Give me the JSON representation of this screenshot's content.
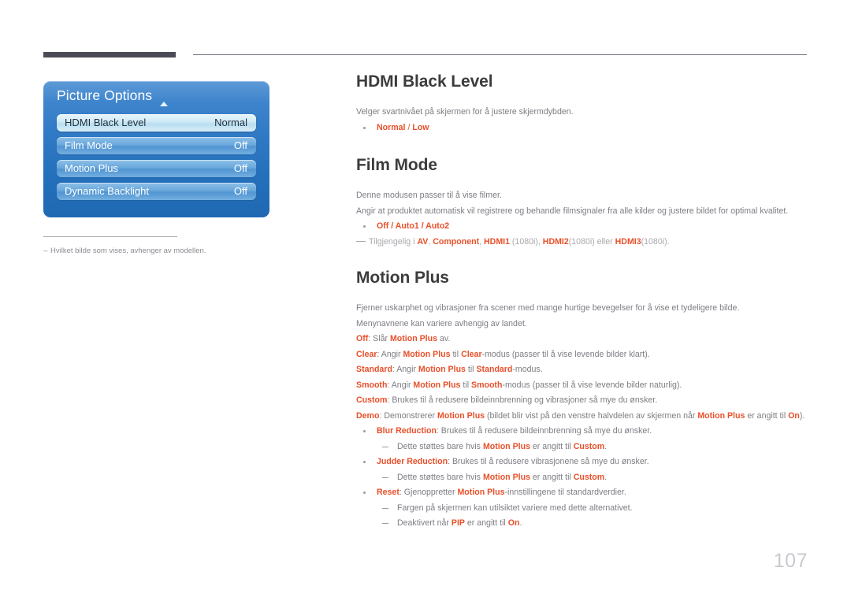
{
  "page": {
    "number": "107"
  },
  "osd": {
    "title": "Picture Options",
    "rows": [
      {
        "label": "HDMI Black Level",
        "value": "Normal",
        "selected": true
      },
      {
        "label": "Film Mode",
        "value": "Off",
        "selected": false
      },
      {
        "label": "Motion Plus",
        "value": "Off",
        "selected": false
      },
      {
        "label": "Dynamic Backlight",
        "value": "Off",
        "selected": false
      }
    ],
    "footnote": "Hvilket bilde som vises, avhenger av modellen."
  },
  "sections": [
    {
      "heading": "HDMI Black Level",
      "intro": "Velger svartnivået på skjermen for å justere skjermdybden.",
      "options_line": {
        "a": "Normal",
        "sep": " / ",
        "b": "Low"
      }
    },
    {
      "heading": "Film Mode",
      "intro1": "Denne modusen passer til å vise filmer.",
      "intro2": "Angir at produktet automatisk vil registrere og behandle filmsignaler fra alle kilder og justere bildet for optimal kvalitet.",
      "options_line": "Off / Auto1 / Auto2",
      "note": {
        "prefix": "Tilgjengelig i ",
        "av": "AV",
        "comma1": ", ",
        "component": "Component",
        "comma2": ", ",
        "hdmi1": "HDMI1",
        "res1": " (1080i), ",
        "hdmi2": "HDMI2",
        "res2": "(1080i) eller ",
        "hdmi3": "HDMI3",
        "res3": "(1080i)."
      }
    },
    {
      "heading": "Motion Plus",
      "intro1": "Fjerner uskarphet og vibrasjoner fra scener med mange hurtige bevegelser for å vise et tydeligere bilde.",
      "intro2": "Menynavnene kan variere avhengig av landet.",
      "modes": [
        {
          "name": "Off",
          "parts": [
            {
              "t": ": Slår ",
              "k": "n"
            },
            {
              "t": "Motion Plus",
              "k": "b"
            },
            {
              "t": " av.",
              "k": "n"
            }
          ]
        },
        {
          "name": "Clear",
          "parts": [
            {
              "t": ": Angir ",
              "k": "n"
            },
            {
              "t": "Motion Plus",
              "k": "b"
            },
            {
              "t": " til ",
              "k": "n"
            },
            {
              "t": "Clear",
              "k": "b"
            },
            {
              "t": "-modus (passer til å vise levende bilder klart).",
              "k": "n"
            }
          ]
        },
        {
          "name": "Standard",
          "parts": [
            {
              "t": ": Angir ",
              "k": "n"
            },
            {
              "t": "Motion Plus",
              "k": "b"
            },
            {
              "t": " til ",
              "k": "n"
            },
            {
              "t": "Standard",
              "k": "b"
            },
            {
              "t": "-modus.",
              "k": "n"
            }
          ]
        },
        {
          "name": "Smooth",
          "parts": [
            {
              "t": ": Angir ",
              "k": "n"
            },
            {
              "t": "Motion Plus",
              "k": "b"
            },
            {
              "t": " til ",
              "k": "n"
            },
            {
              "t": "Smooth",
              "k": "b"
            },
            {
              "t": "-modus (passer til å vise levende bilder naturlig).",
              "k": "n"
            }
          ]
        },
        {
          "name": "Custom",
          "parts": [
            {
              "t": ": Brukes til å redusere bildeinnbrenning og vibrasjoner så mye du ønsker.",
              "k": "n"
            }
          ]
        },
        {
          "name": "Demo",
          "parts": [
            {
              "t": ": Demonstrerer ",
              "k": "n"
            },
            {
              "t": "Motion Plus",
              "k": "b"
            },
            {
              "t": " (bildet blir vist på den venstre halvdelen av skjermen når ",
              "k": "n"
            },
            {
              "t": "Motion Plus",
              "k": "b"
            },
            {
              "t": " er angitt til ",
              "k": "n"
            },
            {
              "t": "On",
              "k": "b"
            },
            {
              "t": ").",
              "k": "n"
            }
          ]
        }
      ],
      "bullets": [
        {
          "name": "Blur Reduction",
          "rest": ": Brukes til å redusere bildeinnbrenning så mye du ønsker.",
          "sub": [
            {
              "parts": [
                {
                  "t": "Dette støttes bare hvis ",
                  "k": "n"
                },
                {
                  "t": "Motion Plus",
                  "k": "b"
                },
                {
                  "t": " er angitt til ",
                  "k": "n"
                },
                {
                  "t": "Custom",
                  "k": "b"
                },
                {
                  "t": ".",
                  "k": "n"
                }
              ]
            }
          ]
        },
        {
          "name": "Judder Reduction",
          "rest": ": Brukes til å redusere vibrasjonene så mye du ønsker.",
          "sub": [
            {
              "parts": [
                {
                  "t": "Dette støttes bare hvis ",
                  "k": "n"
                },
                {
                  "t": "Motion Plus",
                  "k": "b"
                },
                {
                  "t": " er angitt til ",
                  "k": "n"
                },
                {
                  "t": "Custom",
                  "k": "b"
                },
                {
                  "t": ".",
                  "k": "n"
                }
              ]
            }
          ]
        },
        {
          "name": "Reset",
          "rest2": [
            {
              "t": ": Gjenoppretter ",
              "k": "n"
            },
            {
              "t": "Motion Plus",
              "k": "b"
            },
            {
              "t": "-innstillingene til standardverdier.",
              "k": "n"
            }
          ],
          "sub": [
            {
              "parts": [
                {
                  "t": "Fargen på skjermen kan utilsiktet variere med dette alternativet.",
                  "k": "n"
                }
              ]
            },
            {
              "parts": [
                {
                  "t": "Deaktivert når ",
                  "k": "n"
                },
                {
                  "t": "PIP",
                  "k": "b"
                },
                {
                  "t": " er angitt til ",
                  "k": "n"
                },
                {
                  "t": "On",
                  "k": "b"
                },
                {
                  "t": ".",
                  "k": "n"
                }
              ]
            }
          ]
        }
      ]
    }
  ],
  "colors": {
    "accent": "#e8502a",
    "body_text": "#7d7d84",
    "heading": "#3c3c3c",
    "rule_dark": "#4b4b57",
    "page_number": "#c9c9cf",
    "osd_blue": "#2f78c4"
  }
}
